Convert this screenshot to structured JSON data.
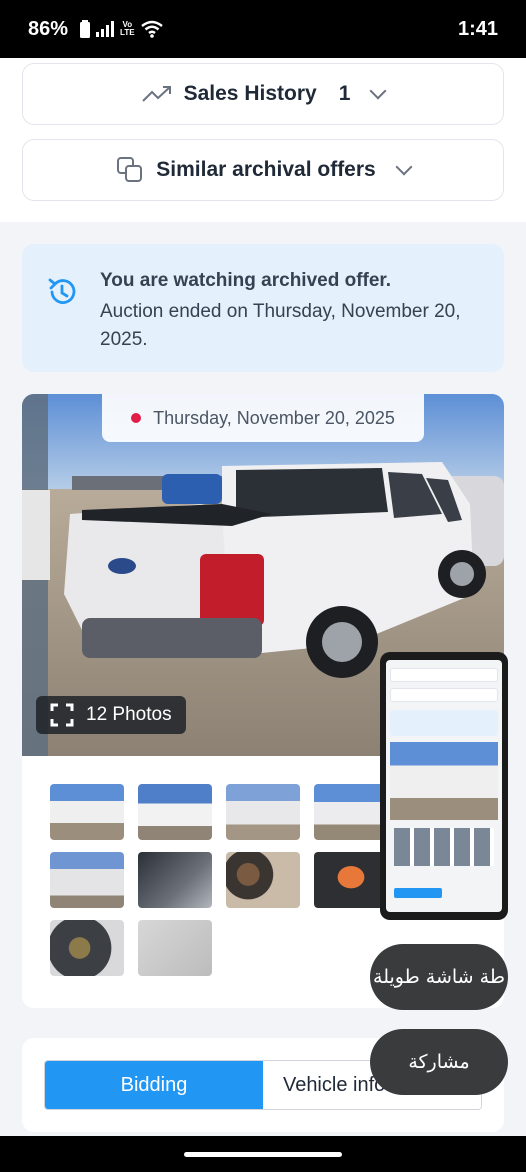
{
  "status_bar": {
    "battery": "86%",
    "network_label_top": "Vo",
    "network_label_bottom": "LTE",
    "time": "1:41"
  },
  "accordions": {
    "sales_history": {
      "label": "Sales History",
      "count": "1"
    },
    "similar_offers": {
      "label": "Similar archival offers"
    }
  },
  "banner": {
    "title": "You are watching archived offer.",
    "message": "Auction ended on Thursday, November 20, 2025."
  },
  "gallery": {
    "date": "Thursday, November 20, 2025",
    "photos_label": "12 Photos"
  },
  "floating_buttons": {
    "long_screenshot": "طة شاشة طويلة",
    "share": "مشاركة"
  },
  "tabs": [
    {
      "label": "Bidding",
      "active": true
    },
    {
      "label": "Vehicle info",
      "active": false
    }
  ],
  "colors": {
    "accent": "#2196f3",
    "banner_bg": "#e4f1fc",
    "live_dot": "#e11d48"
  }
}
